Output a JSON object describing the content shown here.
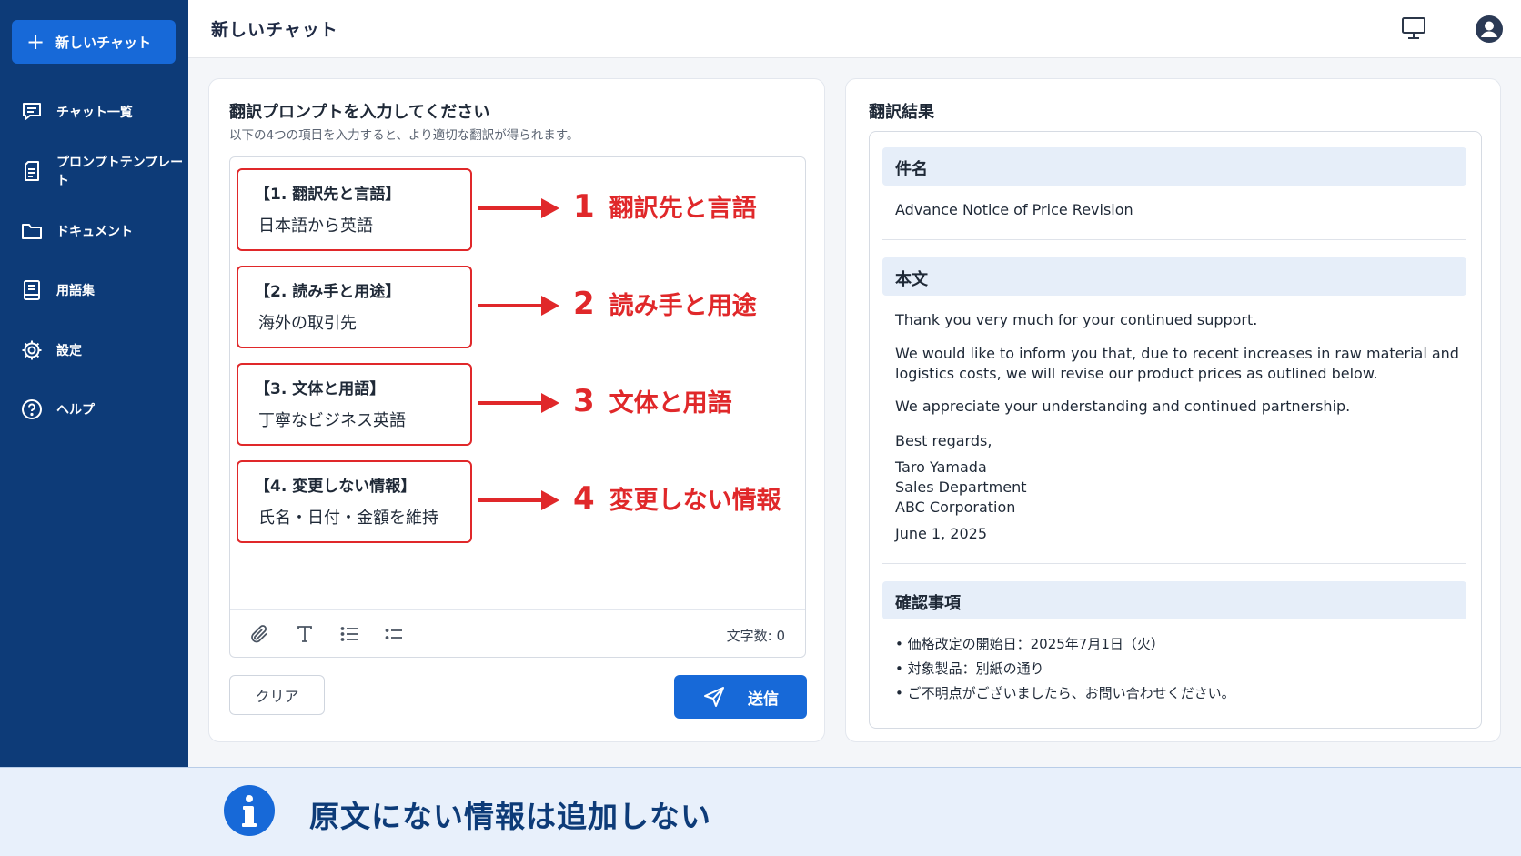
{
  "sidebar": {
    "new_chat_label": "新しいチャット",
    "items": [
      {
        "label": "チャット一覧",
        "icon": "chat-list-icon"
      },
      {
        "label": "プロンプトテンプレート",
        "icon": "template-icon"
      },
      {
        "label": "ドキュメント",
        "icon": "folder-icon"
      },
      {
        "label": "用語集",
        "icon": "glossary-icon"
      },
      {
        "label": "設定",
        "icon": "gear-icon"
      },
      {
        "label": "ヘルプ",
        "icon": "help-icon"
      }
    ]
  },
  "header": {
    "title": "新しいチャット"
  },
  "prompt_panel": {
    "title": "翻訳プロンプトを入力してください",
    "subtitle": "以下の4つの項目を入力すると、より適切な翻訳が得られます。",
    "items": [
      {
        "heading": "【1. 翻訳先と言語】",
        "value": "日本語から英語",
        "num": "1",
        "callout": "翻訳先と言語"
      },
      {
        "heading": "【2. 読み手と用途】",
        "value": "海外の取引先",
        "num": "2",
        "callout": "読み手と用途"
      },
      {
        "heading": "【3. 文体と用語】",
        "value": "丁寧なビジネス英語",
        "num": "3",
        "callout": "文体と用語"
      },
      {
        "heading": "【4. 変更しない情報】",
        "value": "氏名・日付・金額を維持",
        "num": "4",
        "callout": "変更しない情報"
      }
    ],
    "char_count": "文字数: 0",
    "clear_label": "クリア",
    "send_label": "送信"
  },
  "result_panel": {
    "title": "翻訳結果",
    "subject_heading": "件名",
    "subject": "Advance Notice of Price Revision",
    "body_heading": "本文",
    "body": {
      "p1": "Thank you very much for your continued support.",
      "p2": "We would like to inform you that, due to recent increases in raw material and logistics costs, we will revise our product prices as outlined below.",
      "p3": "We appreciate your understanding and continued partnership.",
      "closing": "Best regards,",
      "name": "Taro Yamada",
      "dept": "Sales Department",
      "company": "ABC Corporation",
      "date": "June 1, 2025"
    },
    "confirm_heading": "確認事項",
    "confirm_items": [
      "• 価格改定の開始日：2025年7月1日（火）",
      "• 対象製品：別紙の通り",
      "• ご不明点がございましたら、お問い合わせください。"
    ]
  },
  "footer": {
    "message": "原文にない情報は追加しない"
  },
  "colors": {
    "sidebar": "#0d3b78",
    "accent": "#1769d8",
    "highlight_red": "#e0282a",
    "section_bg": "#e6eef9"
  }
}
